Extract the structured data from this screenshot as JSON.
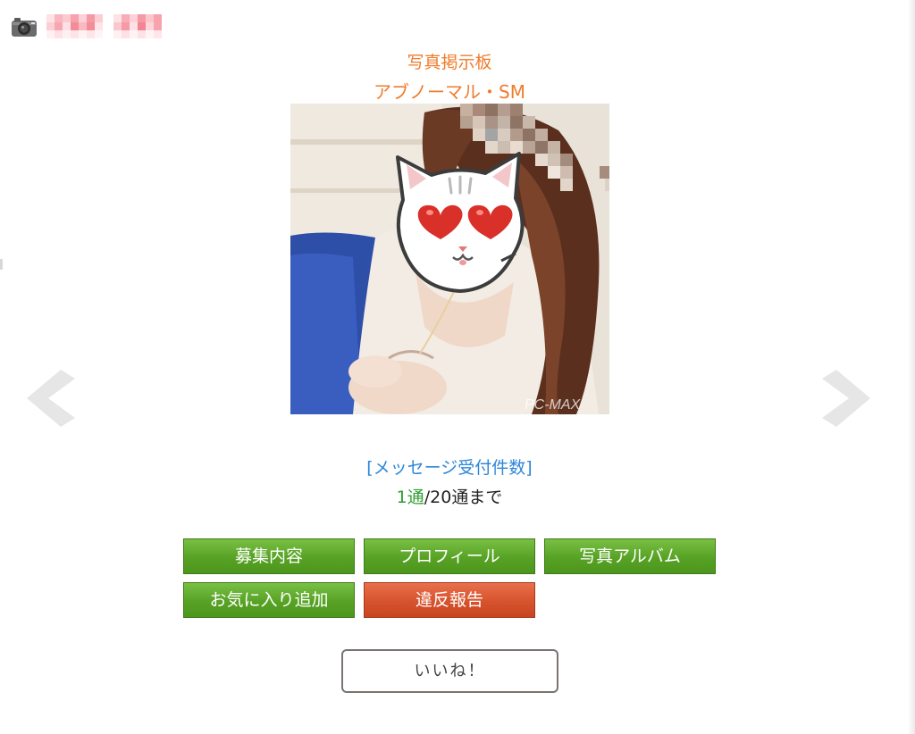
{
  "header": {
    "icon": "camera-icon",
    "name_masked": true
  },
  "board": {
    "title": "写真掲示板",
    "category": "アブノーマル・SM"
  },
  "photo": {
    "description_icon": "profile-photo"
  },
  "navigation": {
    "prev_icon": "chevron-left-icon",
    "next_icon": "chevron-right-icon"
  },
  "messages": {
    "link_label": "[メッセージ受付件数]",
    "count": "1通",
    "limit_text": "/20通まで",
    "count_color": "#2f9e2f"
  },
  "actions": {
    "recruit": "募集内容",
    "profile": "プロフィール",
    "album": "写真アルバム",
    "favorite": "お気に入り追加",
    "report": "違反報告",
    "like": "いいね！"
  },
  "colors": {
    "accent_orange": "#f07c2c",
    "link_blue": "#2e86d9",
    "button_green": "#57a225",
    "button_red": "#d6532d"
  }
}
